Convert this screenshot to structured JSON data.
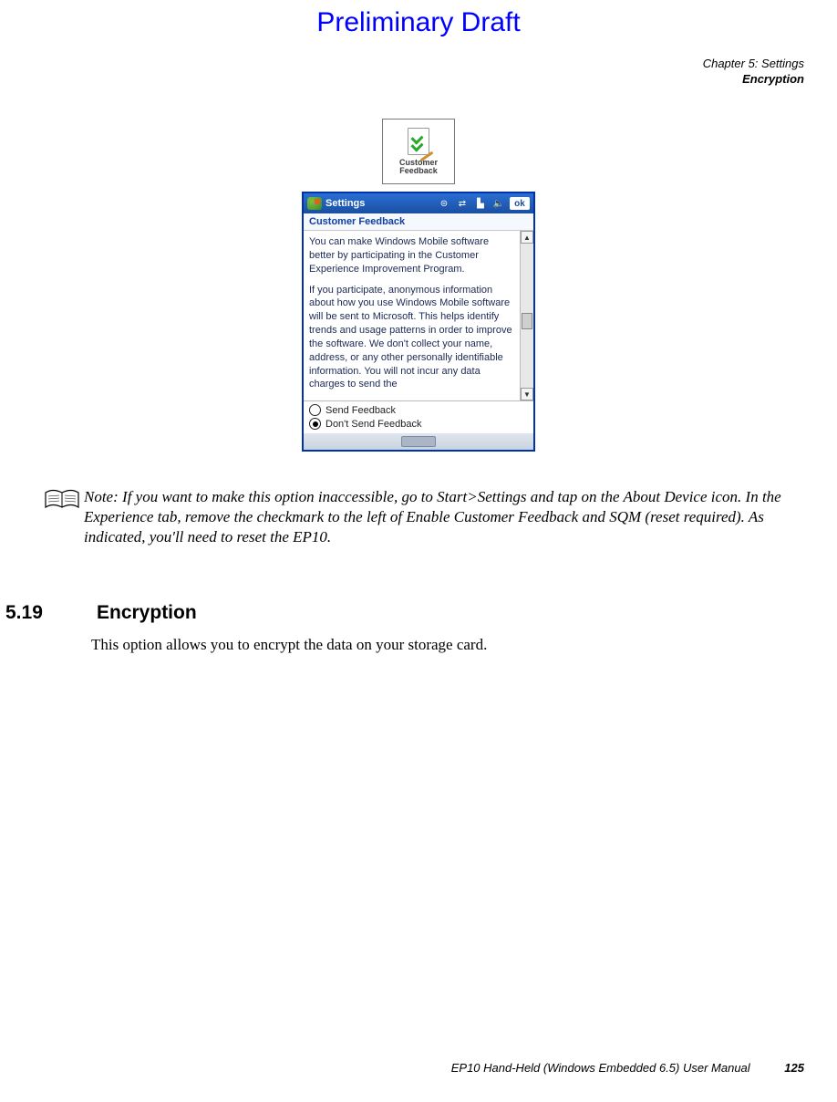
{
  "watermark": "Preliminary Draft",
  "header": {
    "chapter": "Chapter 5:  Settings",
    "section": "Encryption"
  },
  "icon_caption_line1": "Customer",
  "icon_caption_line2": "Feedback",
  "device": {
    "titlebar": {
      "title": "Settings",
      "ok": "ok"
    },
    "subtitle": "Customer Feedback",
    "para1": "You can make Windows Mobile software better by participating in the Customer Experience Improvement Program.",
    "para2": "If you participate, anonymous information about how you use Windows Mobile software will be sent to Microsoft. This helps identify trends and usage patterns in order to improve the software. We don't collect your name, address, or any other personally identifiable information. You will not incur any data charges to send the",
    "radio1": "Send Feedback",
    "radio2": "Don't Send Feedback"
  },
  "note": {
    "label": "Note:",
    "text": "If you want to make this option inaccessible, go to Start>Settings and tap on the About Device icon. In the Experience tab, remove the checkmark to the left of Enable Customer Feedback and SQM (reset required). As indicated, you'll need to reset the EP10."
  },
  "section": {
    "number": "5.19",
    "title": "Encryption",
    "body": "This option allows you to encrypt the data on your storage card."
  },
  "footer": {
    "manual": "EP10 Hand-Held (Windows Embedded 6.5) User Manual",
    "page": "125"
  }
}
